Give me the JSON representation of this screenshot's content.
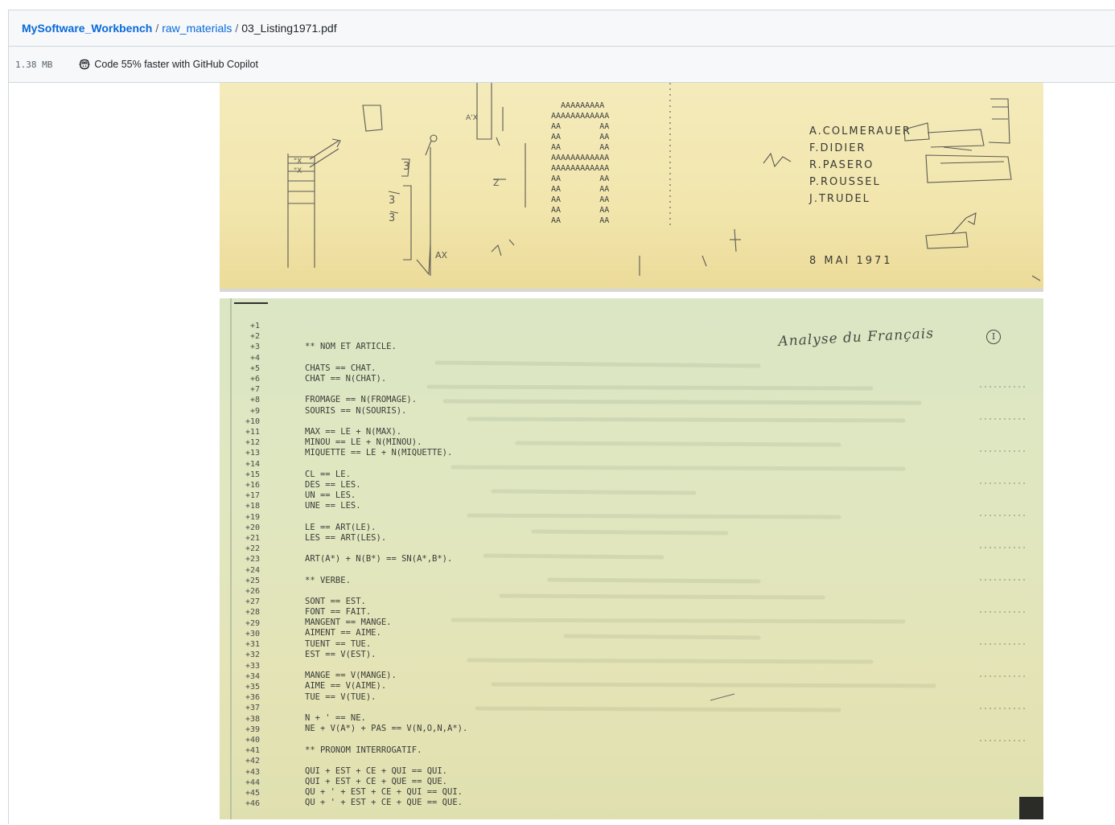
{
  "breadcrumb": {
    "repo": "MySoftware_Workbench",
    "folder": "raw_materials",
    "file": "03_Listing1971.pdf",
    "separator": "/"
  },
  "infobar": {
    "size": "1.38 MB",
    "copilot_label": "Code 55% faster with GitHub Copilot",
    "copilot_icon": "copilot-icon"
  },
  "page1": {
    "banner": "  AAAAAAAAA\nAAAAAAAAAAAA\nAA        AA\nAA        AA\nAA        AA\nAAAAAAAAAAAA\nAAAAAAAAAAAA\nAA        AA\nAA        AA\nAA        AA\nAA        AA\nAA        AA",
    "authors": [
      "A.COLMERAUER",
      "F.DIDIER",
      "R.PASERO",
      "P.ROUSSEL",
      "J.TRUDEL"
    ],
    "date": "8 MAI 1971",
    "margin_notes": [
      "A'X",
      "AX"
    ]
  },
  "page2": {
    "title": "Analyse du Français",
    "page_number": "I",
    "line_numbers": [
      "+1",
      "+2",
      "+3",
      "+4",
      "+5",
      "+6",
      "+7",
      "+8",
      "+9",
      "+10",
      "+11",
      "+12",
      "+13",
      "+14",
      "+15",
      "+16",
      "+17",
      "+18",
      "+19",
      "+20",
      "+21",
      "+22",
      "+23",
      "+24",
      "+25",
      "+26",
      "+27",
      "+28",
      "+29",
      "+30",
      "+31",
      "+32",
      "+33",
      "+34",
      "+35",
      "+36",
      "+37",
      "+38",
      "+39",
      "+40",
      "+41",
      "+42",
      "+43",
      "+44",
      "+45",
      "+46"
    ],
    "code_lines": [
      "",
      "",
      "** NOM ET ARTICLE.",
      "",
      "CHATS == CHAT.",
      "CHAT == N(CHAT).",
      "",
      "FROMAGE == N(FROMAGE).",
      "SOURIS == N(SOURIS).",
      "",
      "MAX == LE + N(MAX).",
      "MINOU == LE + N(MINOU).",
      "MIQUETTE == LE + N(MIQUETTE).",
      "",
      "CL == LE.",
      "DES == LES.",
      "UN == LES.",
      "UNE == LES.",
      "",
      "LE == ART(LE).",
      "LES == ART(LES).",
      "",
      "ART(A*) + N(B*) == SN(A*,B*).",
      "",
      "** VERBE.",
      "",
      "SONT == EST.",
      "FONT == FAIT.",
      "MANGENT == MANGE.",
      "AIMENT == AIME.",
      "TUENT == TUE.",
      "EST == V(EST).",
      "",
      "MANGE == V(MANGE).",
      "AIME == V(AIME).",
      "TUE == V(TUE).",
      "",
      "N + ' == NE.",
      "NE + V(A*) + PAS == V(N,O,N,A*).",
      "",
      "** PRONOM INTERROGATIF.",
      "",
      "QUI + EST + CE + QUI == QUI.",
      "QUI + EST + CE + QUE == QUE.",
      "QU + ' + EST + CE + QUI == QUI.",
      "QU + ' + EST + CE + QUE == QUE."
    ]
  }
}
